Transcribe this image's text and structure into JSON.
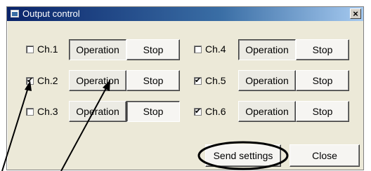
{
  "window": {
    "title": "Output control",
    "close_glyph": "×"
  },
  "channels": [
    {
      "label": "Ch.1",
      "checked": false,
      "operation_label": "Operation",
      "stop_label": "Stop"
    },
    {
      "label": "Ch.2",
      "checked": true,
      "operation_label": "Operation",
      "stop_label": "Stop"
    },
    {
      "label": "Ch.3",
      "checked": false,
      "operation_label": "Operation",
      "stop_label": "Stop"
    },
    {
      "label": "Ch.4",
      "checked": false,
      "operation_label": "Operation",
      "stop_label": "Stop"
    },
    {
      "label": "Ch.5",
      "checked": true,
      "operation_label": "Operation",
      "stop_label": "Stop"
    },
    {
      "label": "Ch.6",
      "checked": true,
      "operation_label": "Operation",
      "stop_label": "Stop"
    }
  ],
  "footer": {
    "send_label": "Send settings",
    "close_label": "Close"
  },
  "check_glyph": "✔",
  "colors": {
    "titlebar_start": "#0a246a",
    "titlebar_end": "#a6caf0",
    "dialog_bg": "#ece9d8"
  }
}
